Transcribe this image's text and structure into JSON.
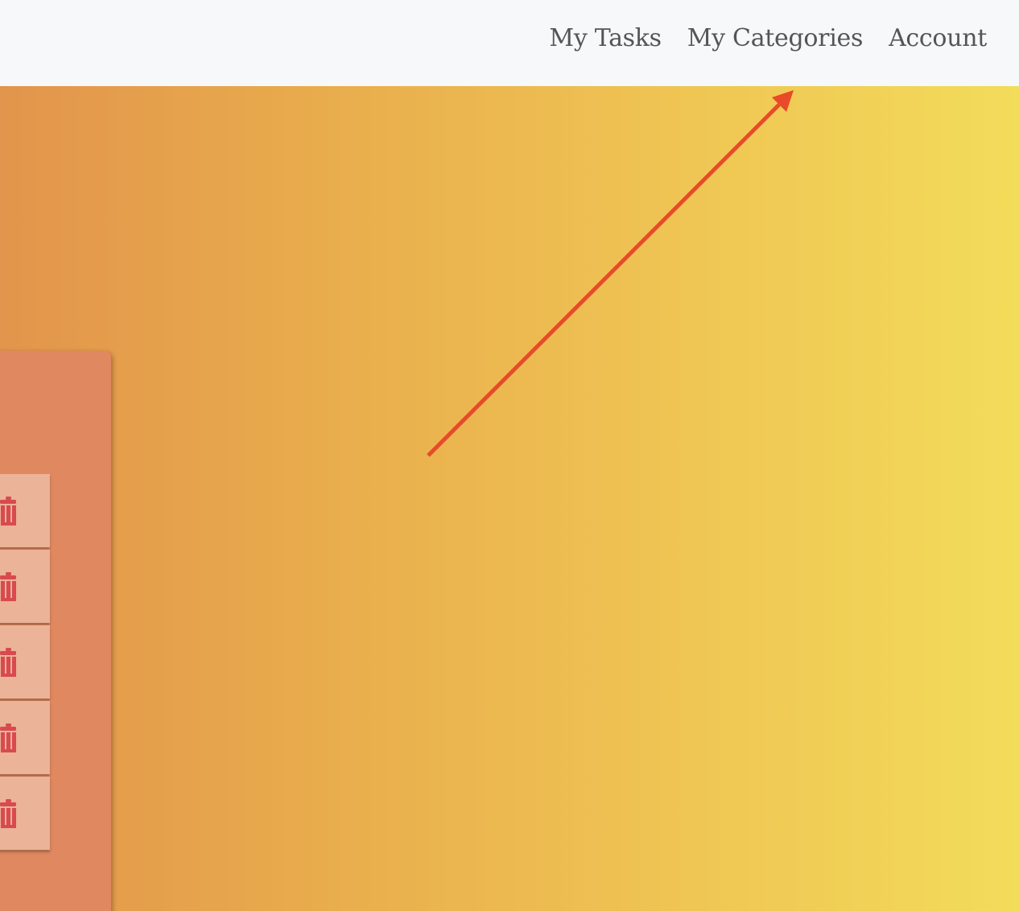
{
  "navbar": {
    "links": [
      {
        "label": "My Tasks"
      },
      {
        "label": "My Categories"
      },
      {
        "label": "Account"
      }
    ]
  },
  "colors": {
    "navbar_bg": "#f7f8fa",
    "nav_text": "#555555",
    "gradient_start": "#e2954c",
    "gradient_end": "#f3dc5a",
    "panel_bg": "#e0885f",
    "list_item_bg": "#ebb397",
    "trash_icon": "#d84a4f",
    "annotation_arrow": "#e84a2a"
  },
  "list": {
    "items": [
      {
        "icon": "trash-icon"
      },
      {
        "icon": "trash-icon"
      },
      {
        "icon": "trash-icon"
      },
      {
        "icon": "trash-icon"
      },
      {
        "icon": "trash-icon"
      }
    ]
  },
  "annotation": {
    "icon": "arrow-icon",
    "points_to": "My Categories"
  }
}
